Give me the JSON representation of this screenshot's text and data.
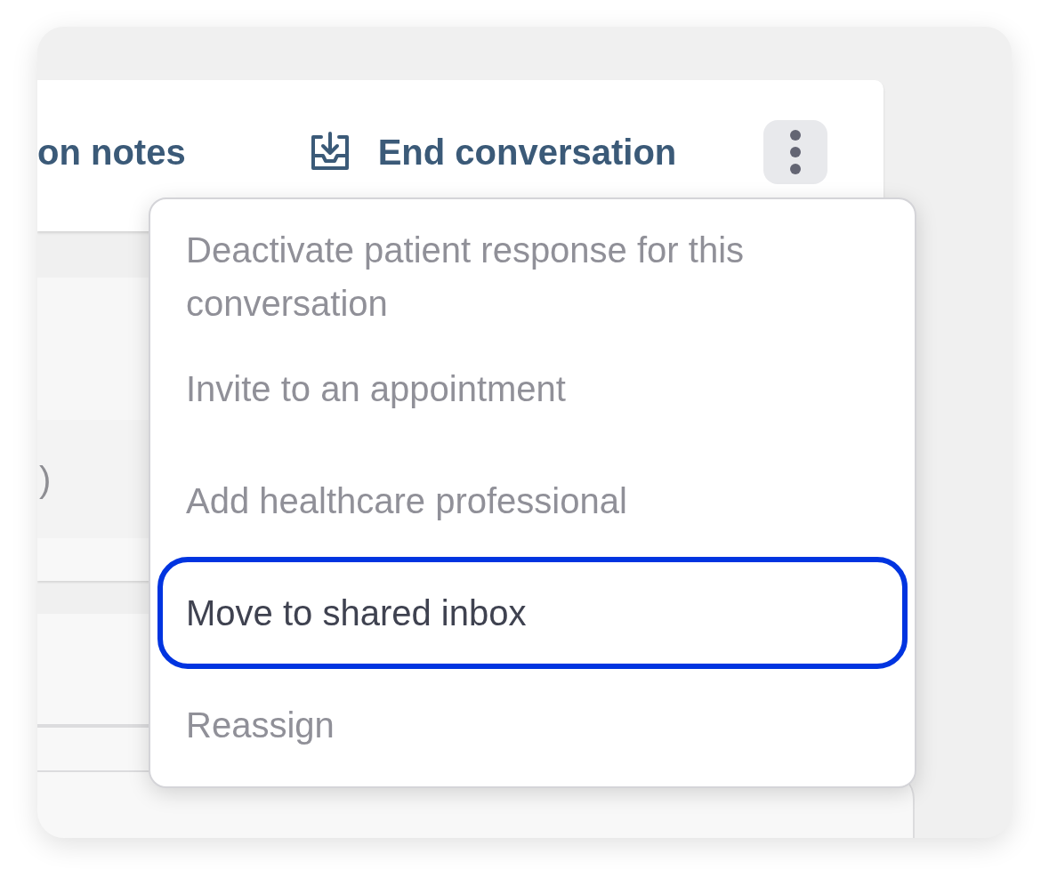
{
  "header": {
    "notes_link": "on notes",
    "end_button": "End conversation"
  },
  "background": {
    "row_text": ")"
  },
  "menu": {
    "items": [
      {
        "label": "Deactivate patient response for this conversation",
        "focused": false
      },
      {
        "label": "Invite to an appointment",
        "focused": false
      },
      {
        "label": "Add healthcare professional",
        "focused": false
      },
      {
        "label": "Move to shared inbox",
        "focused": true
      },
      {
        "label": "Reassign",
        "focused": false
      }
    ]
  }
}
